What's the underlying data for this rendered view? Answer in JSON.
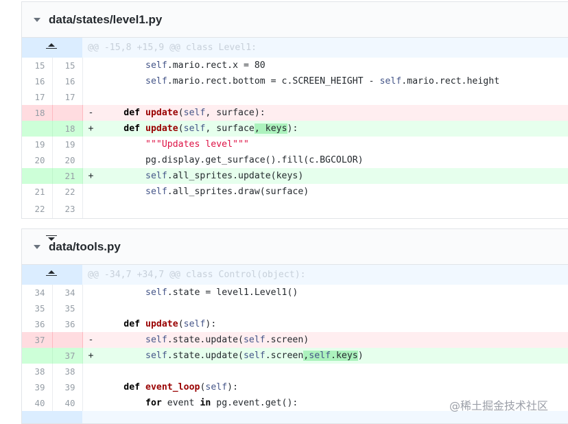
{
  "files": [
    {
      "path": "data/states/level1.py",
      "hunk": "@@ -15,8 +15,9 @@ class Level1:",
      "lines": [
        {
          "type": "ctx",
          "old": "15",
          "new": "15",
          "marker": " ",
          "code": "        self.mario.rect.x = 80"
        },
        {
          "type": "ctx",
          "old": "16",
          "new": "16",
          "marker": " ",
          "code": "        self.mario.rect.bottom = c.SCREEN_HEIGHT - self.mario.rect.height"
        },
        {
          "type": "ctx",
          "old": "17",
          "new": "17",
          "marker": " ",
          "code": ""
        },
        {
          "type": "del",
          "old": "18",
          "new": "",
          "marker": "-",
          "code": "    def update(self, surface):"
        },
        {
          "type": "add",
          "old": "",
          "new": "18",
          "marker": "+",
          "code": "    def update(self, surface, keys):"
        },
        {
          "type": "ctx",
          "old": "19",
          "new": "19",
          "marker": " ",
          "code": "        \"\"\"Updates level\"\"\""
        },
        {
          "type": "ctx",
          "old": "20",
          "new": "20",
          "marker": " ",
          "code": "        pg.display.get_surface().fill(c.BGCOLOR)"
        },
        {
          "type": "add",
          "old": "",
          "new": "21",
          "marker": "+",
          "code": "        self.all_sprites.update(keys)"
        },
        {
          "type": "ctx",
          "old": "21",
          "new": "22",
          "marker": " ",
          "code": "        self.all_sprites.draw(surface)"
        },
        {
          "type": "ctx",
          "old": "22",
          "new": "23",
          "marker": " ",
          "code": ""
        }
      ]
    },
    {
      "path": "data/tools.py",
      "hunk": "@@ -34,7 +34,7 @@ class Control(object):",
      "lines": [
        {
          "type": "ctx",
          "old": "34",
          "new": "34",
          "marker": " ",
          "code": "        self.state = level1.Level1()"
        },
        {
          "type": "ctx",
          "old": "35",
          "new": "35",
          "marker": " ",
          "code": ""
        },
        {
          "type": "ctx",
          "old": "36",
          "new": "36",
          "marker": " ",
          "code": "    def update(self):"
        },
        {
          "type": "del",
          "old": "37",
          "new": "",
          "marker": "-",
          "code": "        self.state.update(self.screen)"
        },
        {
          "type": "add",
          "old": "",
          "new": "37",
          "marker": "+",
          "code": "        self.state.update(self.screen,self.keys)"
        },
        {
          "type": "ctx",
          "old": "38",
          "new": "38",
          "marker": " ",
          "code": ""
        },
        {
          "type": "ctx",
          "old": "39",
          "new": "39",
          "marker": " ",
          "code": "    def event_loop(self):"
        },
        {
          "type": "ctx",
          "old": "40",
          "new": "40",
          "marker": " ",
          "code": "        for event in pg.event.get():"
        }
      ]
    }
  ],
  "watermark": "@稀土掘金技术社区"
}
